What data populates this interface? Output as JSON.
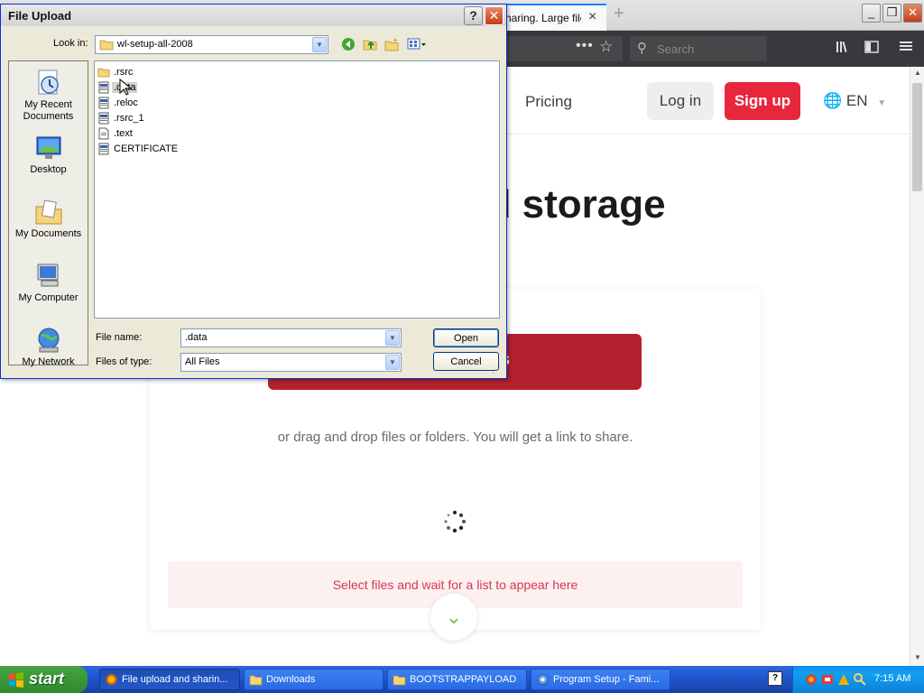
{
  "browser": {
    "tab_title": "haring. Large file",
    "tab_close": "×",
    "new_tab": "+",
    "search_placeholder": "Search",
    "url_more": "•••",
    "win_min": "_",
    "win_restore": "❐",
    "win_close": "✕"
  },
  "site": {
    "nav_pricing": "Pricing",
    "login": "Log in",
    "signup": "Sign up",
    "language": "EN",
    "hero_title": "d cloud storage",
    "select_button_tail": "s",
    "drag_text": "or drag and drop files or folders. You will get a link to share.",
    "empty_list": "Select files and wait for a list to appear here",
    "accent_color": "#e8263c"
  },
  "dialog": {
    "title": "File Upload",
    "help": "?",
    "close": "✕",
    "look_in_label": "Look in:",
    "look_in_value": "wl-setup-all-2008",
    "places": [
      {
        "label": "My Recent Documents",
        "icon": "recent-documents-icon"
      },
      {
        "label": "Desktop",
        "icon": "desktop-icon"
      },
      {
        "label": "My Documents",
        "icon": "my-documents-icon"
      },
      {
        "label": "My Computer",
        "icon": "my-computer-icon"
      },
      {
        "label": "My Network",
        "icon": "my-network-icon"
      }
    ],
    "files": [
      {
        "name": ".rsrc",
        "type": "folder"
      },
      {
        "name": ".data",
        "type": "file",
        "selected": true
      },
      {
        "name": ".reloc",
        "type": "file"
      },
      {
        "name": ".rsrc_1",
        "type": "file"
      },
      {
        "name": ".text",
        "type": "file"
      },
      {
        "name": "CERTIFICATE",
        "type": "file"
      }
    ],
    "file_name_label": "File name:",
    "file_name_value": ".data",
    "file_type_label": "Files of type:",
    "file_type_value": "All Files",
    "open_button": "Open",
    "cancel_button": "Cancel"
  },
  "taskbar": {
    "start": "start",
    "tasks": [
      {
        "label": "File upload and sharin...",
        "active": true
      },
      {
        "label": "Downloads",
        "active": false
      },
      {
        "label": "BOOTSTRAPPAYLOAD",
        "active": false
      },
      {
        "label": "Program Setup - Fami...",
        "active": false
      }
    ],
    "clock": "7:15 AM"
  }
}
